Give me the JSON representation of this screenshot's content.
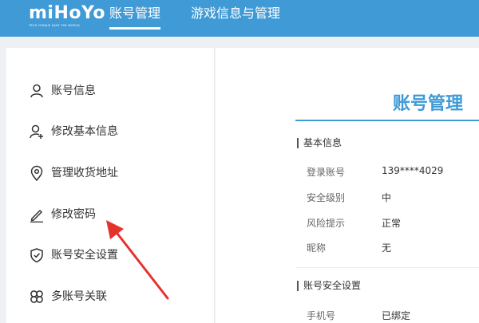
{
  "header": {
    "logo_text": "miHoYo",
    "logo_tagline": "TECH OTAKUS SAVE THE WORLD",
    "nav": [
      {
        "label": "账号管理",
        "active": true
      },
      {
        "label": "游戏信息与管理",
        "active": false
      }
    ]
  },
  "sidebar": {
    "items": [
      {
        "label": "账号信息",
        "icon": "user-icon"
      },
      {
        "label": "修改基本信息",
        "icon": "user-edit-icon"
      },
      {
        "label": "管理收货地址",
        "icon": "location-pin-icon"
      },
      {
        "label": "修改密码",
        "icon": "pencil-icon"
      },
      {
        "label": "账号安全设置",
        "icon": "shield-check-icon"
      },
      {
        "label": "多账号关联",
        "icon": "link-circles-icon"
      }
    ]
  },
  "main": {
    "title": "账号管理",
    "basic_info": {
      "heading": "基本信息",
      "rows": [
        {
          "key": "登录账号",
          "value": "139****4029"
        },
        {
          "key": "安全级别",
          "value": "中"
        },
        {
          "key": "风险提示",
          "value": "正常"
        },
        {
          "key": "昵称",
          "value": "无"
        }
      ]
    },
    "security": {
      "heading": "账号安全设置",
      "rows": [
        {
          "key": "手机号",
          "value": "已绑定"
        }
      ]
    }
  },
  "colors": {
    "brand_blue": "#3f9ad6",
    "arrow_red": "#e5322d"
  }
}
